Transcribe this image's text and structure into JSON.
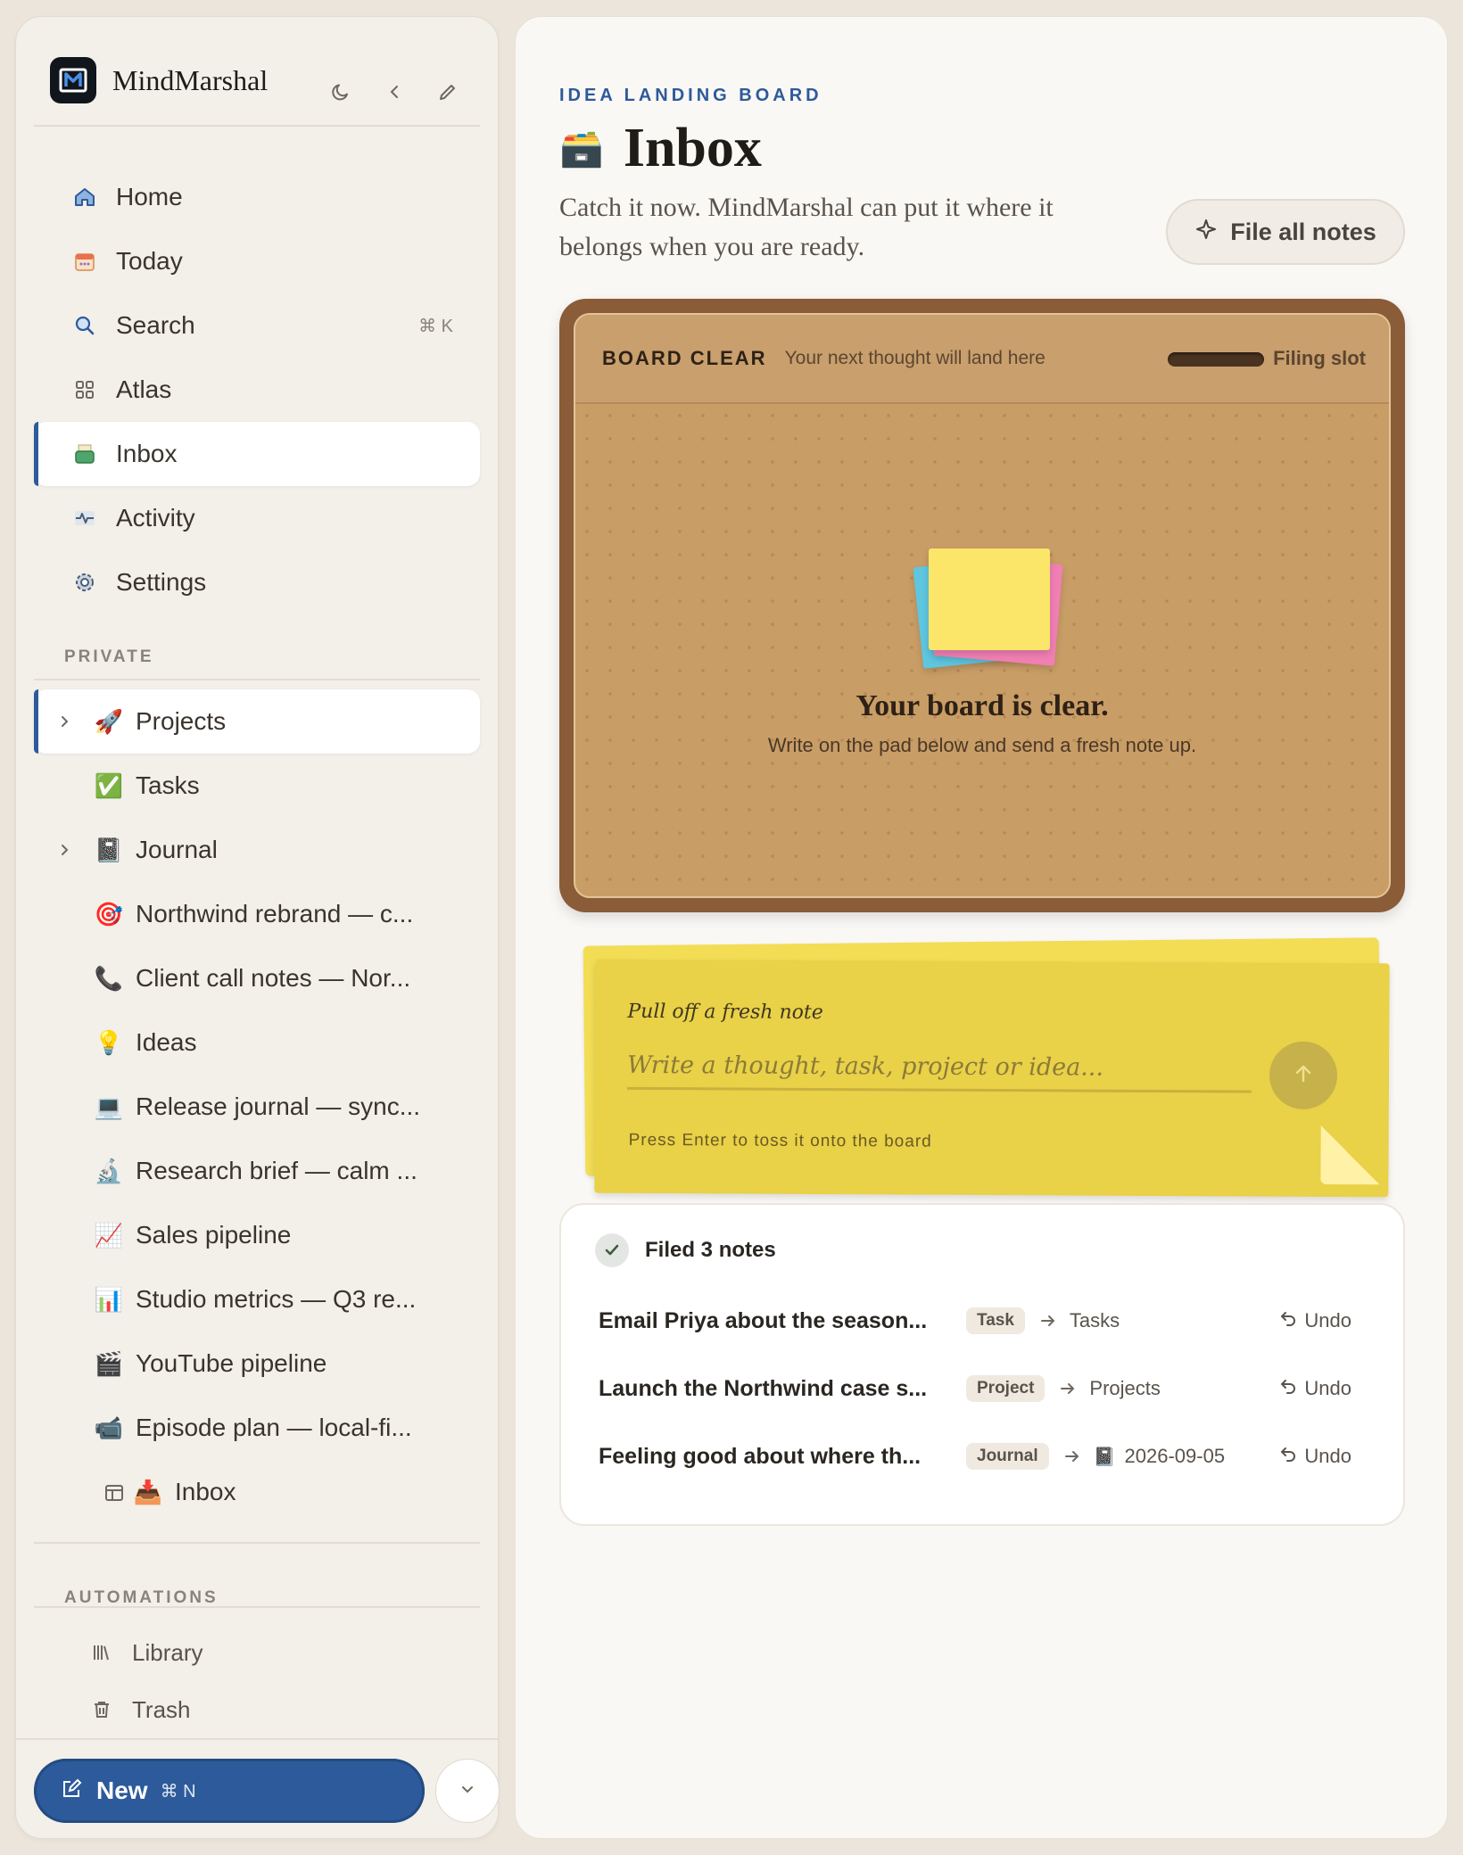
{
  "app": {
    "name": "MindMarshal"
  },
  "nav": {
    "items": [
      {
        "label": "Home",
        "icon": "home-icon"
      },
      {
        "label": "Today",
        "icon": "calendar-icon"
      },
      {
        "label": "Search",
        "icon": "search-icon",
        "shortcut": "⌘ K"
      },
      {
        "label": "Atlas",
        "icon": "grid-icon"
      },
      {
        "label": "Inbox",
        "icon": "inbox-tray-icon",
        "active": true
      },
      {
        "label": "Activity",
        "icon": "pulse-icon"
      },
      {
        "label": "Settings",
        "icon": "gear-icon"
      }
    ]
  },
  "private": {
    "label": "PRIVATE",
    "items": [
      {
        "label": "Projects",
        "emoji": "🚀",
        "expandable": true
      },
      {
        "label": "Tasks",
        "emoji": "✅"
      },
      {
        "label": "Journal",
        "emoji": "📓",
        "expandable": true
      },
      {
        "label": "Northwind rebrand — c...",
        "emoji": "🎯"
      },
      {
        "label": "Client call notes — Nor...",
        "emoji": "📞"
      },
      {
        "label": "Ideas",
        "emoji": "💡"
      },
      {
        "label": "Release journal — sync...",
        "emoji": "💻"
      },
      {
        "label": "Research brief — calm ...",
        "emoji": "🔬"
      },
      {
        "label": "Sales pipeline",
        "emoji": "📈"
      },
      {
        "label": "Studio metrics — Q3 re...",
        "emoji": "📊"
      },
      {
        "label": "YouTube pipeline",
        "emoji": "🎬"
      },
      {
        "label": "Episode plan — local-fi...",
        "emoji": "📹"
      },
      {
        "label": "Inbox",
        "emoji": "📥"
      }
    ]
  },
  "automations": {
    "label": "AUTOMATIONS"
  },
  "bottom_links": [
    {
      "label": "Library",
      "icon": "library-icon"
    },
    {
      "label": "Trash",
      "icon": "trash-icon"
    }
  ],
  "new_button": {
    "label": "New",
    "shortcut": "⌘ N"
  },
  "page": {
    "eyebrow": "IDEA LANDING BOARD",
    "emoji": "🗃️",
    "title": "Inbox",
    "subtitle": "Catch it now. MindMarshal can put it where it belongs when you are ready.",
    "file_all_label": "File all notes"
  },
  "board": {
    "status": "BOARD CLEAR",
    "hint": "Your next thought will land here",
    "slot_label": "Filing slot",
    "empty_title": "Your board is clear.",
    "empty_sub": "Write on the pad below and send a fresh note up."
  },
  "pad": {
    "label": "Pull off a fresh note",
    "placeholder": "Write a thought, task, project or idea...",
    "value": "",
    "hint": "Press Enter to toss it onto the board"
  },
  "filed": {
    "title": "Filed 3 notes",
    "rows": [
      {
        "text": "Email Priya about the season...",
        "badge": "Task",
        "dest": "Tasks",
        "dest_emoji": "",
        "undo": "Undo"
      },
      {
        "text": "Launch the Northwind case s...",
        "badge": "Project",
        "dest": "Projects",
        "dest_emoji": "",
        "undo": "Undo"
      },
      {
        "text": "Feeling good about where th...",
        "badge": "Journal",
        "dest": "2026-09-05",
        "dest_emoji": "📓",
        "undo": "Undo"
      }
    ]
  },
  "colors": {
    "accent": "#2d5a9b",
    "board_frame": "#8a5c38",
    "cork": "#c99d66",
    "note_yellow": "#e9d148"
  }
}
